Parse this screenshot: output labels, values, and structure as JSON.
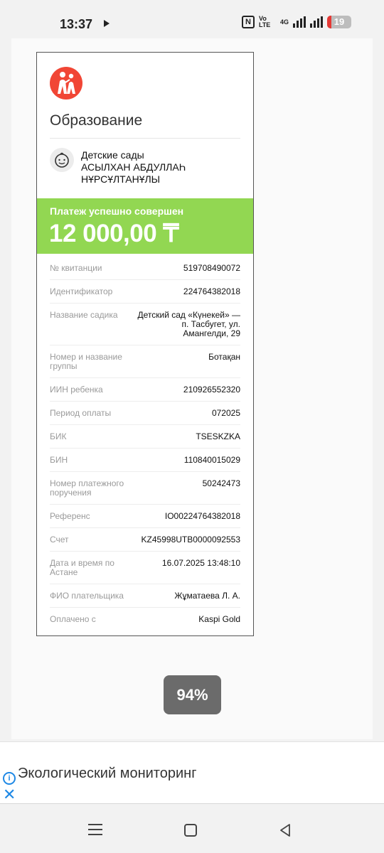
{
  "status_bar": {
    "time": "13:37",
    "network_volte": "Vo LTE",
    "network_type": "4G",
    "battery_level": "19",
    "battery_fraction": 0.19
  },
  "receipt": {
    "category": "Образование",
    "provider_lines": [
      "Детские сады",
      "АСЫЛХАН АБДУЛЛАҺ",
      "НҰРСҰЛТАНҰЛЫ"
    ],
    "status": "Платеж успешно совершен",
    "amount": "12 000,00 ₸",
    "colors": {
      "banner": "#92d752",
      "logo": "#f14635"
    },
    "rows": [
      {
        "label": "№ квитанции",
        "value": "519708490072"
      },
      {
        "label": "Идентификатор",
        "value": "224764382018"
      },
      {
        "label": "Название садика",
        "value": "Детский сад «Күнекей» — п. Тасбугет, ул. Амангелди, 29"
      },
      {
        "label": "Номер и название группы",
        "value": "Ботақан"
      },
      {
        "label": "ИИН ребенка",
        "value": "210926552320"
      },
      {
        "label": "Период оплаты",
        "value": "072025"
      },
      {
        "label": "БИК",
        "value": "TSESKZKA"
      },
      {
        "label": "БИН",
        "value": "110840015029"
      },
      {
        "label": "Номер платежного поручения",
        "value": "50242473"
      },
      {
        "label": "Референс",
        "value": "IO00224764382018"
      },
      {
        "label": "Счет",
        "value": "KZ45998UTB0000092553"
      },
      {
        "label": "Дата и время по Астане",
        "value": "16.07.2025 13:48:10"
      },
      {
        "label": "ФИО плательщика",
        "value": "Жұматаева Л. А."
      },
      {
        "label": "Оплачено с",
        "value": "Kaspi Gold"
      }
    ]
  },
  "zoom": {
    "label": "94%"
  },
  "ad": {
    "text": "Экологический мониторинг",
    "info_icon": "info-icon",
    "close_icon": "close-icon"
  },
  "navbar": {
    "icons": [
      "menu-icon",
      "home-icon",
      "back-icon"
    ]
  }
}
